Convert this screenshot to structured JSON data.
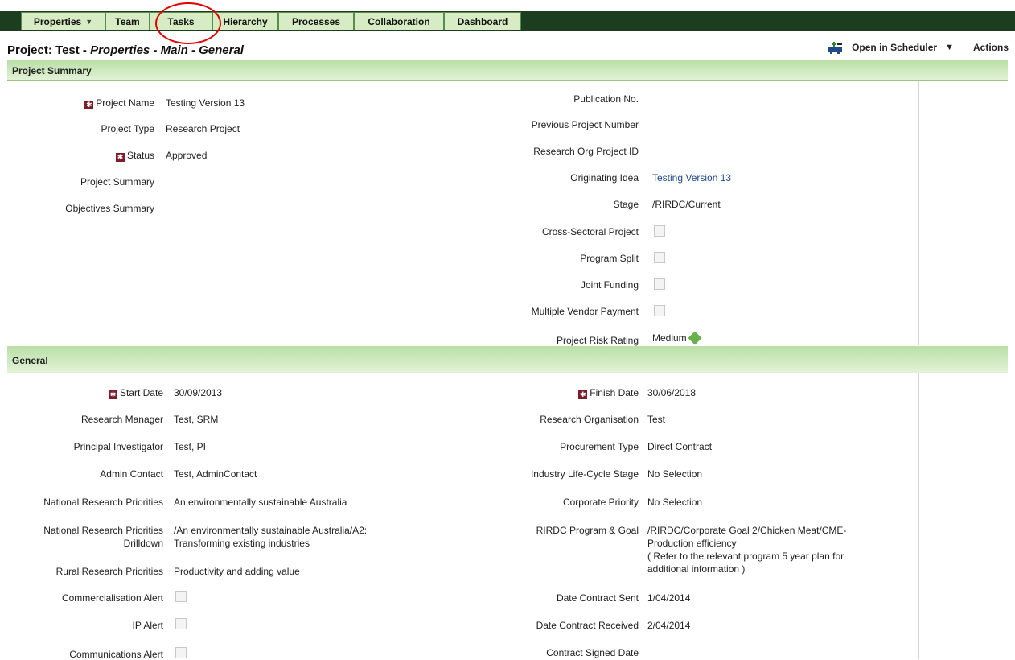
{
  "nav": {
    "tabs": [
      {
        "label": "Properties",
        "dropdown": true
      },
      {
        "label": "Team"
      },
      {
        "label": "Tasks"
      },
      {
        "label": "Hierarchy"
      },
      {
        "label": "Processes"
      },
      {
        "label": "Collaboration"
      },
      {
        "label": "Dashboard"
      }
    ],
    "highlighted_tab": "Tasks"
  },
  "header": {
    "title_prefix": "Project: Test - ",
    "title_italic": "Properties - Main - General",
    "open_in_scheduler": "Open in Scheduler",
    "actions": "Actions"
  },
  "summary": {
    "section_title": "Project Summary",
    "left": [
      {
        "label": "Project Name",
        "value": "Testing Version 13",
        "required": true
      },
      {
        "label": "Project Type",
        "value": "Research Project"
      },
      {
        "label": "Status",
        "value": "Approved",
        "required": true
      },
      {
        "label": "Project Summary",
        "value": ""
      },
      {
        "label": "Objectives Summary",
        "value": ""
      }
    ],
    "right": [
      {
        "label": "Publication No.",
        "value": ""
      },
      {
        "label": "Previous Project Number",
        "value": ""
      },
      {
        "label": "Research Org Project ID",
        "value": ""
      },
      {
        "label": "Originating Idea",
        "value": "Testing Version 13",
        "link": true
      },
      {
        "label": "Stage",
        "value": "/RIRDC/Current"
      },
      {
        "label": "Cross-Sectoral Project",
        "checkbox": true
      },
      {
        "label": "Program Split",
        "checkbox": true
      },
      {
        "label": "Joint Funding",
        "checkbox": true
      },
      {
        "label": "Multiple Vendor Payment",
        "checkbox": true
      },
      {
        "label": "Project Risk Rating",
        "value": "Medium"
      }
    ]
  },
  "general": {
    "section_title": "General",
    "left": [
      {
        "label": "Start Date",
        "value": "30/09/2013",
        "required": true
      },
      {
        "label": "Research Manager",
        "value": "Test, SRM"
      },
      {
        "label": "Principal Investigator",
        "value": "Test, PI"
      },
      {
        "label": "Admin Contact",
        "value": "Test, AdminContact"
      },
      {
        "label": "National Research Priorities",
        "value": "An environmentally sustainable Australia"
      },
      {
        "label": "National Research Priorities",
        "label2": "Drilldown",
        "value": "/An environmentally sustainable Australia/A2:",
        "value2": "Transforming existing industries"
      },
      {
        "label": "Rural Research Priorities",
        "value": "Productivity and adding value"
      },
      {
        "label": "Commercialisation Alert",
        "checkbox": true
      },
      {
        "label": "IP Alert",
        "checkbox": true
      },
      {
        "label": "Communications Alert",
        "checkbox": true
      }
    ],
    "right": [
      {
        "label": "Finish Date",
        "value": "30/06/2018",
        "required": true
      },
      {
        "label": "Research Organisation",
        "value": "Test"
      },
      {
        "label": "Procurement Type",
        "value": "Direct Contract"
      },
      {
        "label": "Industry Life-Cycle Stage",
        "value": "No Selection"
      },
      {
        "label": "Corporate Priority",
        "value": "No Selection"
      },
      {
        "label": "RIRDC Program & Goal",
        "value": "/RIRDC/Corporate Goal 2/Chicken Meat/CME-",
        "value2": "Production efficiency",
        "value3": "( Refer to the relevant program 5 year plan for",
        "value4": "additional information )"
      },
      {
        "label": "Date Contract Sent",
        "value": "1/04/2014"
      },
      {
        "label": "Date Contract Received",
        "value": "2/04/2014"
      },
      {
        "label": "Contract Signed Date",
        "value": ""
      }
    ]
  }
}
